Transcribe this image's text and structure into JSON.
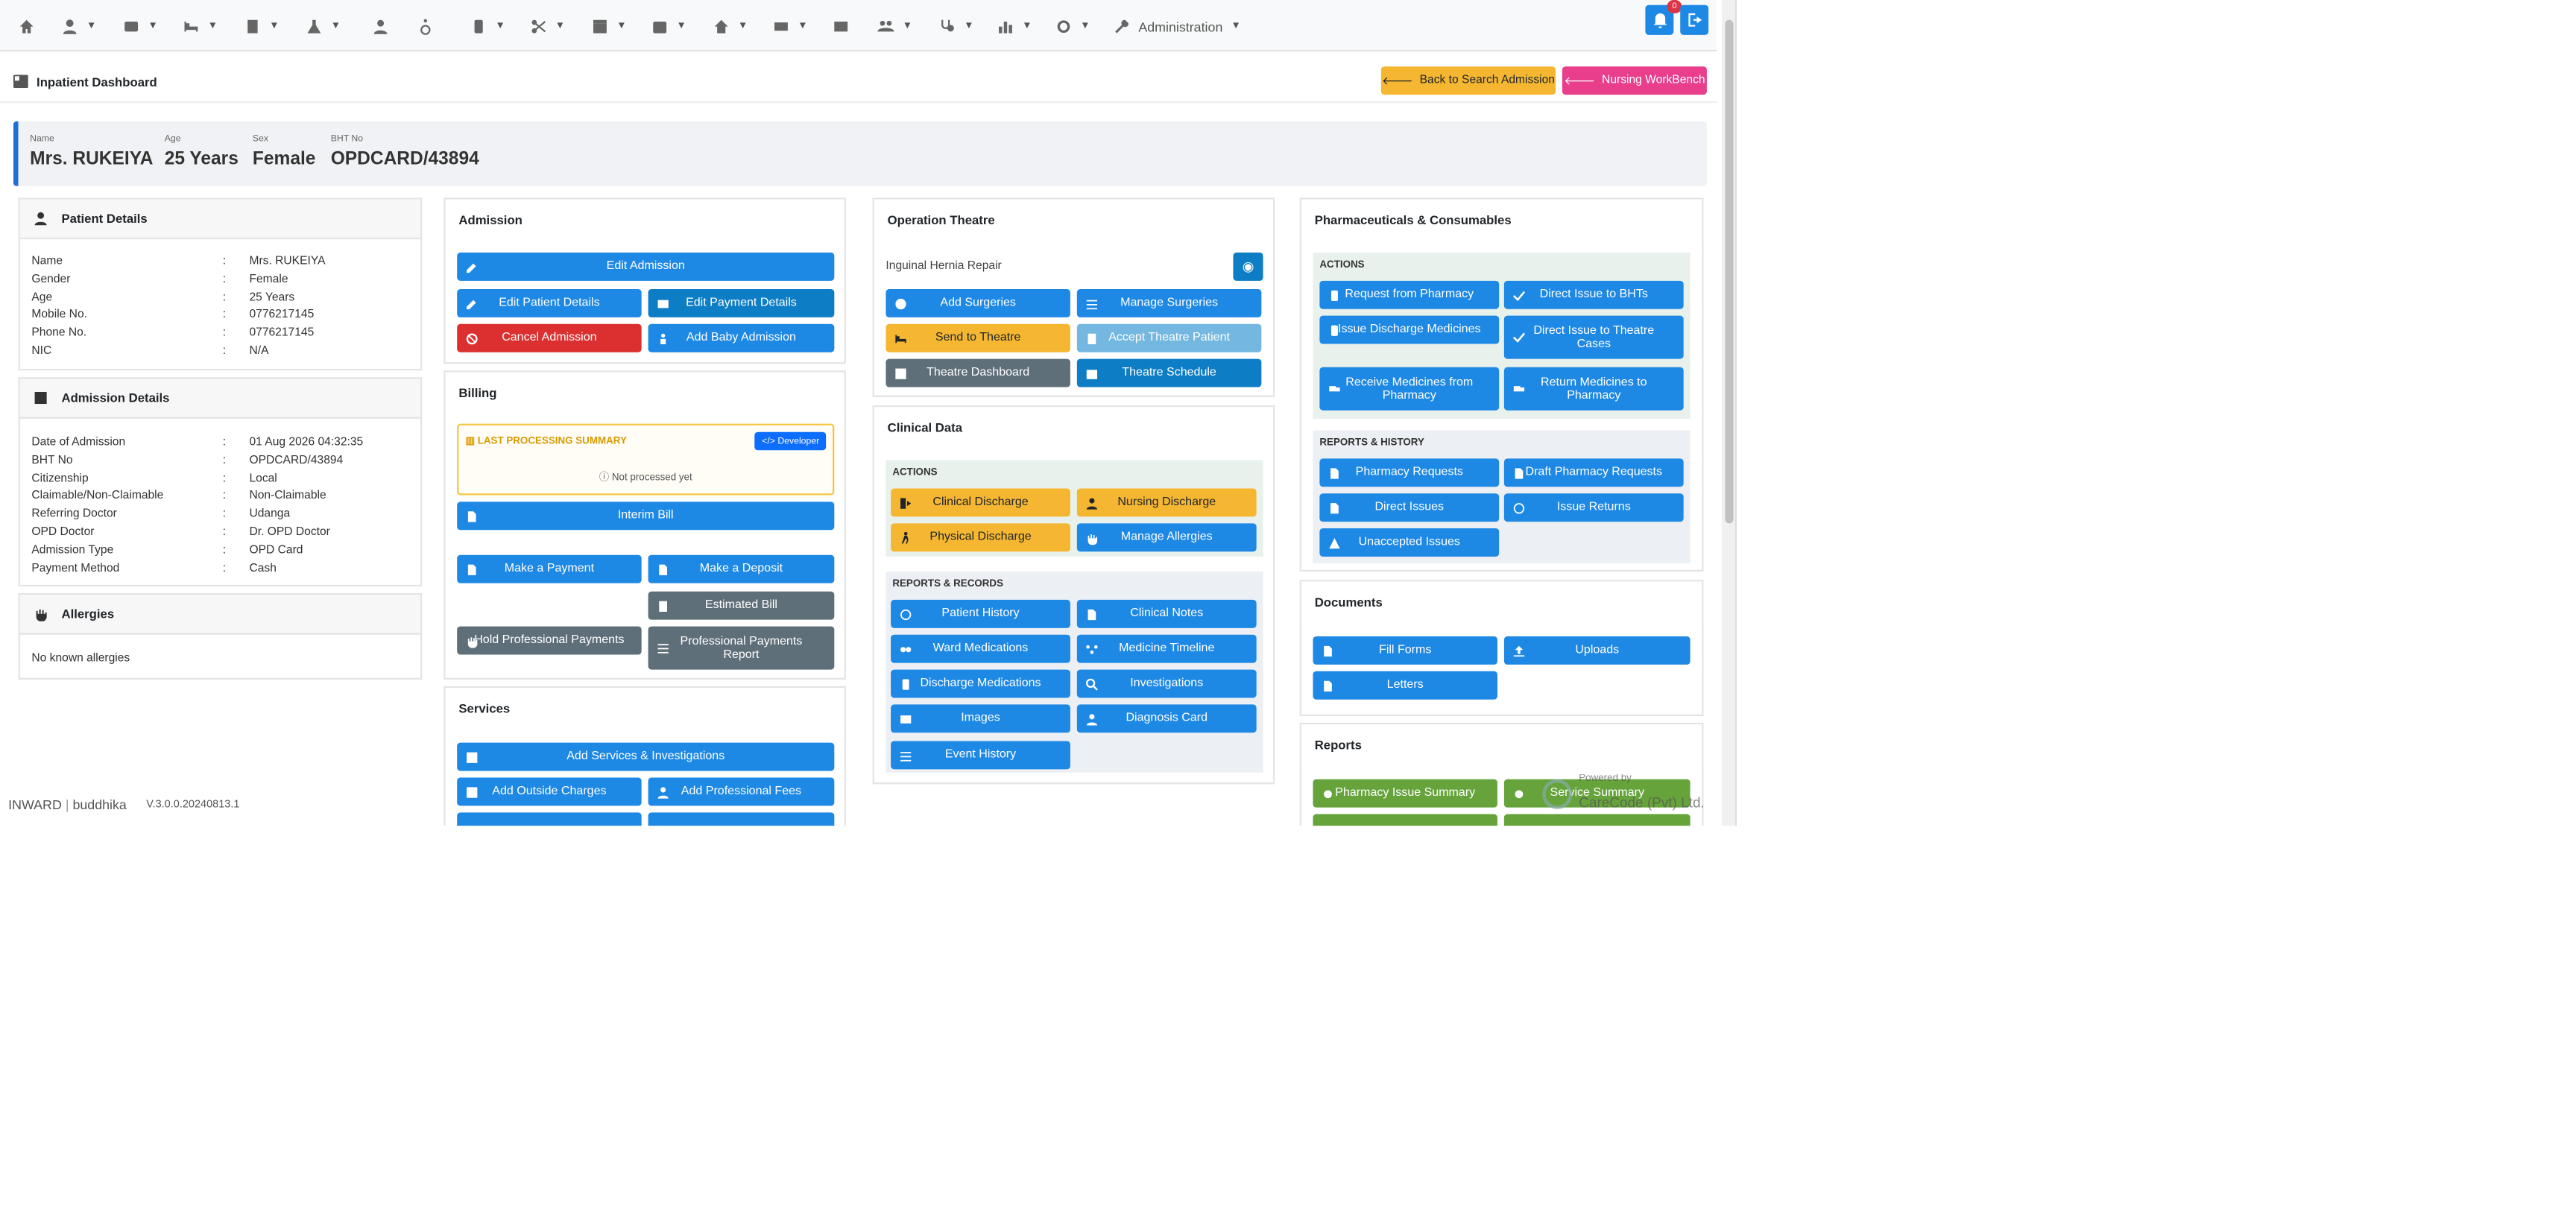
{
  "nav": {
    "admin_label": "Administration",
    "notification_count": "0"
  },
  "header": {
    "title": "Inpatient Dashboard",
    "back_label": "Back to Search Admission",
    "nursing_label": "Nursing WorkBench"
  },
  "patient": {
    "name_label": "Name",
    "name": "Mrs. RUKEIYA",
    "age_label": "Age",
    "age": "25 Years",
    "sex_label": "Sex",
    "sex": "Female",
    "bht_label": "BHT No",
    "bht": "OPDCARD/43894"
  },
  "patient_details": {
    "title": "Patient Details",
    "rows": [
      {
        "k": "Name",
        "v": "Mrs. RUKEIYA"
      },
      {
        "k": "Gender",
        "v": "Female"
      },
      {
        "k": "Age",
        "v": "25 Years"
      },
      {
        "k": "Mobile No.",
        "v": "0776217145"
      },
      {
        "k": "Phone No.",
        "v": "0776217145"
      },
      {
        "k": "NIC",
        "v": "N/A"
      }
    ]
  },
  "admission_details": {
    "title": "Admission Details",
    "rows": [
      {
        "k": "Date of Admission",
        "v": "01 Aug 2026 04:32:35"
      },
      {
        "k": "BHT No",
        "v": "OPDCARD/43894"
      },
      {
        "k": "Citizenship",
        "v": "Local"
      },
      {
        "k": "Claimable/Non-Claimable",
        "v": "Non-Claimable"
      },
      {
        "k": "Referring Doctor",
        "v": "Udanga"
      },
      {
        "k": "OPD Doctor",
        "v": "Dr. OPD Doctor"
      },
      {
        "k": "Admission Type",
        "v": "OPD Card"
      },
      {
        "k": "Payment Method",
        "v": "Cash"
      }
    ]
  },
  "allergies": {
    "title": "Allergies",
    "text": "No known allergies"
  },
  "colon": ":",
  "admission": {
    "title": "Admission",
    "edit_admission": "Edit Admission",
    "edit_patient": "Edit Patient Details",
    "edit_payment": "Edit Payment Details",
    "cancel": "Cancel Admission",
    "baby": "Add Baby Admission"
  },
  "billing": {
    "title": "Billing",
    "summary_title": "LAST PROCESSING SUMMARY",
    "developer": "Developer",
    "not_processed": "Not processed yet",
    "interim": "Interim Bill",
    "payment": "Make a Payment",
    "deposit": "Make a Deposit",
    "estimated": "Estimated Bill",
    "hold": "Hold Professional Payments",
    "prof_report_1": "Professional Payments",
    "prof_report_2": "Report"
  },
  "services": {
    "title": "Services",
    "add_services": "Add Services & Investigations",
    "outside": "Add Outside Charges",
    "prof_fees": "Add Professional Fees"
  },
  "theatre": {
    "title": "Operation Theatre",
    "procedure": "Inguinal Hernia Repair",
    "add_surg": "Add Surgeries",
    "manage_surg": "Manage Surgeries",
    "send": "Send to Theatre",
    "accept": "Accept Theatre Patient",
    "dashboard": "Theatre Dashboard",
    "schedule": "Theatre Schedule"
  },
  "clinical": {
    "title": "Clinical Data",
    "actions": "ACTIONS",
    "clin_dis": "Clinical Discharge",
    "nurs_dis": "Nursing Discharge",
    "phys_dis": "Physical Discharge",
    "allergies": "Manage Allergies",
    "reports": "REPORTS & RECORDS",
    "history": "Patient History",
    "notes": "Clinical Notes",
    "ward_med": "Ward Medications",
    "timeline": "Medicine Timeline",
    "dis_med": "Discharge Medications",
    "invest": "Investigations",
    "images": "Images",
    "diag": "Diagnosis Card",
    "event": "Event History"
  },
  "pharma": {
    "title": "Pharmaceuticals & Consumables",
    "actions": "ACTIONS",
    "req": "Request from Pharmacy",
    "direct_bht": "Direct Issue to BHTs",
    "issue_dis": "Issue Discharge Medicines",
    "direct_theatre_1": "Direct Issue to Theatre",
    "direct_theatre_2": "Cases",
    "receive_1": "Receive Medicines from",
    "receive_2": "Pharmacy",
    "return_1": "Return Medicines to",
    "return_2": "Pharmacy",
    "reports": "REPORTS & HISTORY",
    "pr": "Pharmacy Requests",
    "draft": "Draft Pharmacy Requests",
    "direct_issues": "Direct Issues",
    "issue_returns": "Issue Returns",
    "unaccepted": "Unaccepted Issues"
  },
  "documents": {
    "title": "Documents",
    "fill": "Fill Forms",
    "uploads": "Uploads",
    "letters": "Letters"
  },
  "reports": {
    "title": "Reports",
    "pis": "Pharmacy Issue Summary",
    "ss": "Service Summary"
  },
  "footer": {
    "app": "INWARD",
    "sep": "|",
    "user": "buddhika",
    "version": "V.3.0.0.20240813.1",
    "powered": "Powered by",
    "company": "CareCode (Pvt) Ltd."
  }
}
